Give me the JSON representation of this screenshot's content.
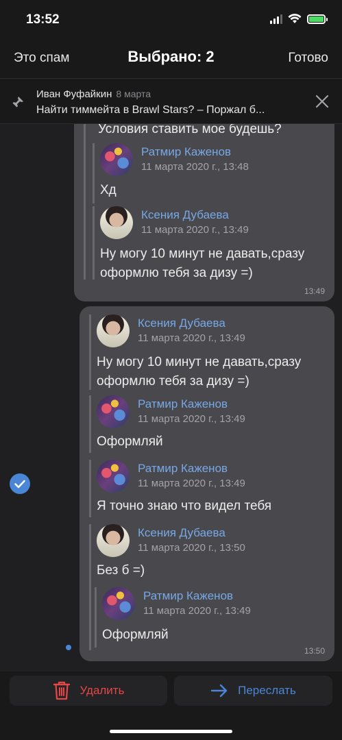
{
  "status": {
    "time": "13:52"
  },
  "nav": {
    "left": "Это спам",
    "title": "Выбрано: 2",
    "right": "Готово"
  },
  "pinned": {
    "author": "Иван Фуфайкин",
    "date": "8 марта",
    "text": "Найти тиммейта в Brawl Stars? – Поржал б..."
  },
  "message1": {
    "top_text": "Условия ставить мое будешь?",
    "fwd1": {
      "name": "Ратмир Каженов",
      "date": "11 марта 2020 г., 13:48",
      "text": "Хд"
    },
    "fwd2": {
      "name": "Ксения Дубаева",
      "date": "11 марта 2020 г., 13:49",
      "text": "Ну могу 10 минут не давать,сразу оформлю тебя за дизу =)"
    },
    "time": "13:49"
  },
  "message2": {
    "fwd1": {
      "name": "Ксения Дубаева",
      "date": "11 марта 2020 г., 13:49",
      "text": "Ну могу 10 минут не давать,сразу оформлю тебя за дизу =)"
    },
    "fwd2": {
      "name": "Ратмир Каженов",
      "date": "11 марта 2020 г., 13:49",
      "text": "Оформляй"
    },
    "fwd3": {
      "name": "Ратмир Каженов",
      "date": "11 марта 2020 г., 13:49",
      "text": "Я точно знаю что видел тебя"
    },
    "fwd4": {
      "name": "Ксения Дубаева",
      "date": "11 марта 2020 г., 13:50",
      "text": "Без б =)"
    },
    "fwd5": {
      "name": "Ратмир Каженов",
      "date": "11 марта 2020 г., 13:49",
      "text": "Оформляй"
    },
    "time": "13:50"
  },
  "actions": {
    "delete": "Удалить",
    "forward": "Переслать"
  },
  "colors": {
    "accent": "#4a86d6",
    "danger": "#e64646",
    "name": "#77a8e6",
    "bubble": "#49494d",
    "background": "#1f1f21"
  },
  "icons": [
    "pin-icon",
    "close-icon",
    "check-icon",
    "trash-icon",
    "arrow-right-icon",
    "wifi-icon",
    "battery-icon",
    "signal-icon"
  ]
}
